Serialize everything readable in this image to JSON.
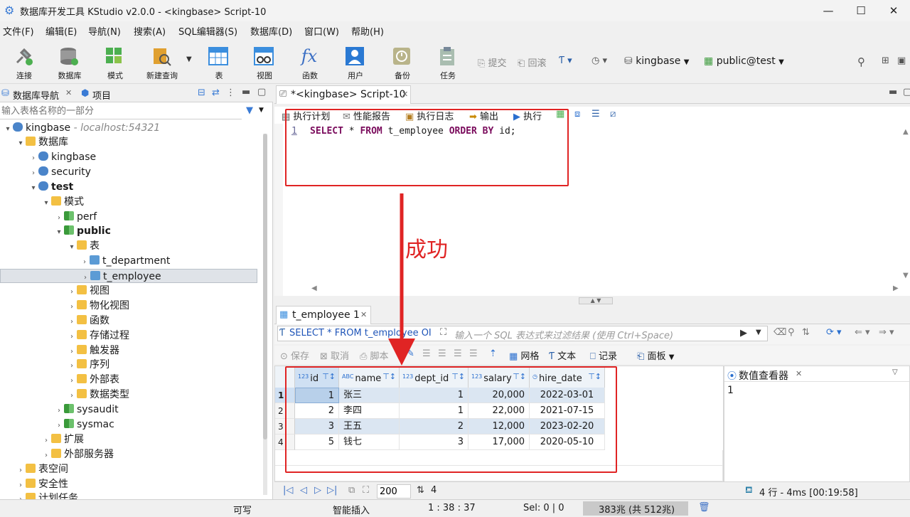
{
  "window": {
    "title": "数据库开发工具 KStudio v2.0.0 - <kingbase> Script-10",
    "minimize": "—",
    "maximize": "☐",
    "close": "✕"
  },
  "menu": [
    "文件(F)",
    "编辑(E)",
    "导航(N)",
    "搜索(A)",
    "SQL编辑器(S)",
    "数据库(D)",
    "窗口(W)",
    "帮助(H)"
  ],
  "toolbar": {
    "buttons": [
      "连接",
      "数据库",
      "模式",
      "新建查询",
      "表",
      "视图",
      "函数",
      "用户",
      "备份",
      "任务"
    ],
    "commit": "提交",
    "rollback": "回滚",
    "datasource": "kingbase",
    "schema": "public@test"
  },
  "left": {
    "tab_nav": "数据库导航",
    "tab_project": "项目",
    "filter_placeholder": "输入表格名称的一部分",
    "tree": [
      {
        "label": "kingbase",
        "extra": " - localhost:54321",
        "indent": 0,
        "arrow": "▾",
        "icon": "db",
        "bold": false
      },
      {
        "label": "数据库",
        "indent": 1,
        "arrow": "▾",
        "icon": "folder"
      },
      {
        "label": "kingbase",
        "indent": 2,
        "arrow": "›",
        "icon": "db"
      },
      {
        "label": "security",
        "indent": 2,
        "arrow": "›",
        "icon": "db"
      },
      {
        "label": "test",
        "indent": 2,
        "arrow": "▾",
        "icon": "db",
        "bold": true
      },
      {
        "label": "模式",
        "indent": 3,
        "arrow": "▾",
        "icon": "folder"
      },
      {
        "label": "perf",
        "indent": 4,
        "arrow": "›",
        "icon": "schema"
      },
      {
        "label": "public",
        "indent": 4,
        "arrow": "▾",
        "icon": "schema",
        "bold": true
      },
      {
        "label": "表",
        "indent": 5,
        "arrow": "▾",
        "icon": "folder"
      },
      {
        "label": "t_department",
        "indent": 6,
        "arrow": "›",
        "icon": "tbl"
      },
      {
        "label": "t_employee",
        "indent": 6,
        "arrow": "›",
        "icon": "tbl",
        "selected": true
      },
      {
        "label": "视图",
        "indent": 5,
        "arrow": "›",
        "icon": "folder"
      },
      {
        "label": "物化视图",
        "indent": 5,
        "arrow": "›",
        "icon": "folder"
      },
      {
        "label": "函数",
        "indent": 5,
        "arrow": "›",
        "icon": "folder"
      },
      {
        "label": "存储过程",
        "indent": 5,
        "arrow": "›",
        "icon": "folder"
      },
      {
        "label": "触发器",
        "indent": 5,
        "arrow": "›",
        "icon": "folder"
      },
      {
        "label": "序列",
        "indent": 5,
        "arrow": "›",
        "icon": "folder"
      },
      {
        "label": "外部表",
        "indent": 5,
        "arrow": "›",
        "icon": "folder"
      },
      {
        "label": "数据类型",
        "indent": 5,
        "arrow": "›",
        "icon": "folder"
      },
      {
        "label": "sysaudit",
        "indent": 4,
        "arrow": "›",
        "icon": "schema"
      },
      {
        "label": "sysmac",
        "indent": 4,
        "arrow": "›",
        "icon": "schema"
      },
      {
        "label": "扩展",
        "indent": 3,
        "arrow": "›",
        "icon": "folder"
      },
      {
        "label": "外部服务器",
        "indent": 3,
        "arrow": "›",
        "icon": "folder"
      },
      {
        "label": "表空间",
        "indent": 1,
        "arrow": "›",
        "icon": "folder"
      },
      {
        "label": "安全性",
        "indent": 1,
        "arrow": "›",
        "icon": "folder"
      },
      {
        "label": "计划任务",
        "indent": 1,
        "arrow": "›",
        "icon": "folder"
      }
    ]
  },
  "editor": {
    "tab": "*<kingbase> Script-10",
    "actions": [
      "执行计划",
      "性能报告",
      "执行日志",
      "输出",
      "执行"
    ],
    "line_no": "1",
    "sql": {
      "k1": "SELECT",
      "t1": " * ",
      "k2": "FROM",
      "t2": " t_employee ",
      "k3": "ORDER BY",
      "t3": " id;"
    }
  },
  "annotation": {
    "text": "成功"
  },
  "results": {
    "tab": "t_employee 1",
    "query": "SELECT * FROM t_employee OI",
    "filter_placeholder": "输入一个 SQL 表达式来过滤结果 (使用 Ctrl+Space)",
    "actions": [
      "保存",
      "取消",
      "脚本",
      "网格",
      "文本",
      "记录",
      "面板"
    ],
    "columns": [
      {
        "type": "123",
        "name": "id"
      },
      {
        "type": "ABC",
        "name": "name"
      },
      {
        "type": "123",
        "name": "dept_id"
      },
      {
        "type": "123",
        "name": "salary"
      },
      {
        "type": "◷",
        "name": "hire_date"
      }
    ],
    "rows": [
      {
        "n": "1",
        "id": "1",
        "name": "张三",
        "dept_id": "1",
        "salary": "20,000",
        "hire_date": "2022-03-01"
      },
      {
        "n": "2",
        "id": "2",
        "name": "李四",
        "dept_id": "1",
        "salary": "22,000",
        "hire_date": "2021-07-15"
      },
      {
        "n": "3",
        "id": "3",
        "name": "王五",
        "dept_id": "2",
        "salary": "12,000",
        "hire_date": "2023-02-20"
      },
      {
        "n": "4",
        "id": "5",
        "name": "钱七",
        "dept_id": "3",
        "salary": "17,000",
        "hire_date": "2020-05-10"
      }
    ],
    "viewer_title": "数值查看器",
    "viewer_value": "1",
    "page_size": "200",
    "row_count": "4",
    "summary": "4 行 - 4ms [00:19:58]"
  },
  "status": {
    "writable": "可写",
    "insert_mode": "智能插入",
    "cursor": "1 : 38 : 37",
    "selection": "Sel: 0 | 0",
    "memory": "383兆 (共 512兆)"
  }
}
